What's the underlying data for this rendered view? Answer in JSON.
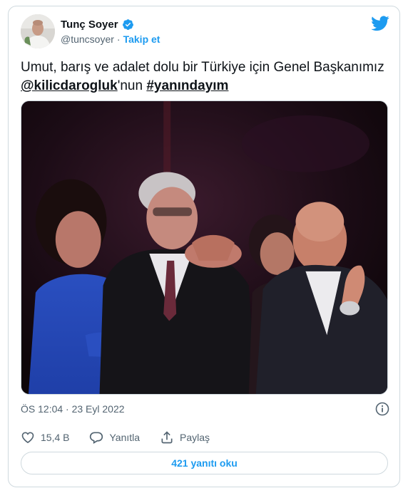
{
  "author": {
    "display_name": "Tunç Soyer",
    "handle": "@tuncsoyer",
    "separator": "·",
    "follow_label": "Takip et"
  },
  "tweet": {
    "text_part1": "Umut, barış ve adalet dolu bir Türkiye için Genel Başkanımız ",
    "mention": "@kilicdarogluk",
    "text_part2": "'nun ",
    "hashtag": "#yanındayım"
  },
  "meta": {
    "timestamp": "ÖS 12:04 · 23 Eyl 2022"
  },
  "actions": {
    "like_count": "15,4 B",
    "reply_label": "Yanıtla",
    "share_label": "Paylaş"
  },
  "replies_button": "421 yanıtı oku",
  "colors": {
    "accent": "#1d9bf0",
    "text": "#0f1419",
    "secondary": "#536471",
    "border": "#cfd9de"
  },
  "icons": [
    "verified-badge-icon",
    "twitter-logo-icon",
    "info-icon",
    "heart-icon",
    "reply-icon",
    "share-icon"
  ]
}
